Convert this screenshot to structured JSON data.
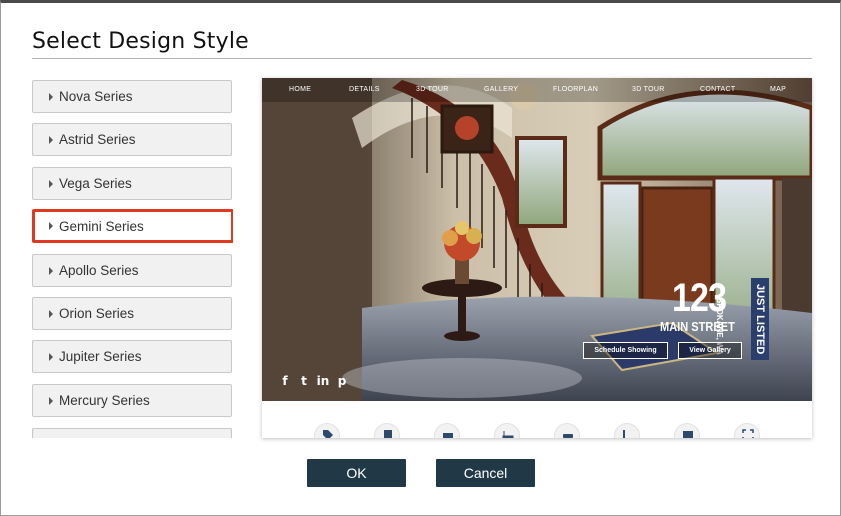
{
  "dialog": {
    "title": "Select Design Style",
    "ok_label": "OK",
    "cancel_label": "Cancel"
  },
  "series": [
    {
      "label": "Nova Series",
      "selected": false
    },
    {
      "label": "Astrid Series",
      "selected": false
    },
    {
      "label": "Vega Series",
      "selected": false
    },
    {
      "label": "Gemini Series",
      "selected": true
    },
    {
      "label": "Apollo Series",
      "selected": false
    },
    {
      "label": "Orion Series",
      "selected": false
    },
    {
      "label": "Jupiter Series",
      "selected": false
    },
    {
      "label": "Mercury Series",
      "selected": false
    }
  ],
  "preview": {
    "nav": [
      "HOME",
      "DETAILS",
      "3D TOUR",
      "GALLERY",
      "FLOORPLAN",
      "3D TOUR",
      "CONTACT",
      "MAP"
    ],
    "address_number": "123",
    "address_city": "SPOKANE, WA",
    "address_street": "MAIN STREET",
    "badge": "JUST LISTED",
    "schedule_button": "Schedule Showing",
    "gallery_button": "View Gallery",
    "social_icons": [
      "facebook-icon",
      "twitter-icon",
      "linkedin-icon",
      "pinterest-icon"
    ],
    "social_glyphs": [
      "f",
      "t",
      "in",
      "p"
    ],
    "feature_icons": [
      "price-tag-icon",
      "document-icon",
      "bed-icon",
      "bath-icon",
      "car-icon",
      "sqft-icon",
      "calendar-icon",
      "expand-icon"
    ]
  },
  "colors": {
    "selection_border": "#e0391f",
    "button_bg": "#213947",
    "badge_bg": "#2b3f6e"
  }
}
